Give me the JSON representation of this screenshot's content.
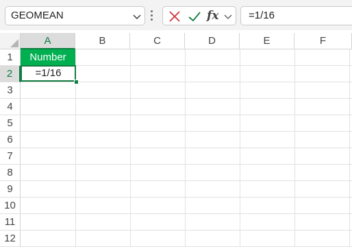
{
  "formula_bar": {
    "name_box": "GEOMEAN",
    "fx_label": "fx",
    "formula_text": "=1/16"
  },
  "columns": [
    "A",
    "B",
    "C",
    "D",
    "E",
    "F"
  ],
  "rows": [
    "1",
    "2",
    "3",
    "4",
    "5",
    "6",
    "7",
    "8",
    "9",
    "10",
    "11",
    "12"
  ],
  "cells": {
    "A1": "Number",
    "A2": "=1/16"
  },
  "active_cell": "A2",
  "colors": {
    "header_fill": "#00b050",
    "selection": "#107c41",
    "cancel": "#d13438",
    "enter": "#107c41"
  }
}
